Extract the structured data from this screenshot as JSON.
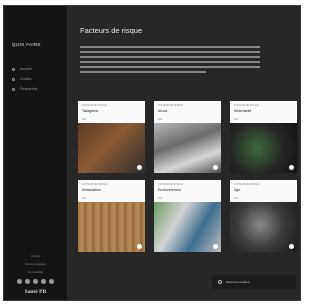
{
  "sidebar": {
    "brand": "QUOI FAIRE",
    "items": [
      {
        "label": "Accueil",
        "icon": "home-icon"
      },
      {
        "label": "Guides",
        "icon": "book-icon"
      },
      {
        "label": "Recherche",
        "icon": "search-icon"
      }
    ],
    "footer_links": [
      "Contact",
      "Mentions légales",
      "Accessibilité"
    ],
    "logo": "Santé PR"
  },
  "main": {
    "title": "Facteurs de risque",
    "cards": [
      {
        "label": "Facteur de risque",
        "title": "Tabagisme",
        "meta": "Voir"
      },
      {
        "label": "Facteur de risque",
        "title": "Alcool",
        "meta": "Voir"
      },
      {
        "label": "Facteur de risque",
        "title": "Sédentarité",
        "meta": "Voir"
      },
      {
        "label": "Facteur de risque",
        "title": "Alimentation",
        "meta": "Voir"
      },
      {
        "label": "Facteur de risque",
        "title": "Environnement",
        "meta": "Voir"
      },
      {
        "label": "Facteur de risque",
        "title": "Âge",
        "meta": "Voir"
      }
    ]
  },
  "cookie": {
    "label": "Gérer les cookies"
  }
}
